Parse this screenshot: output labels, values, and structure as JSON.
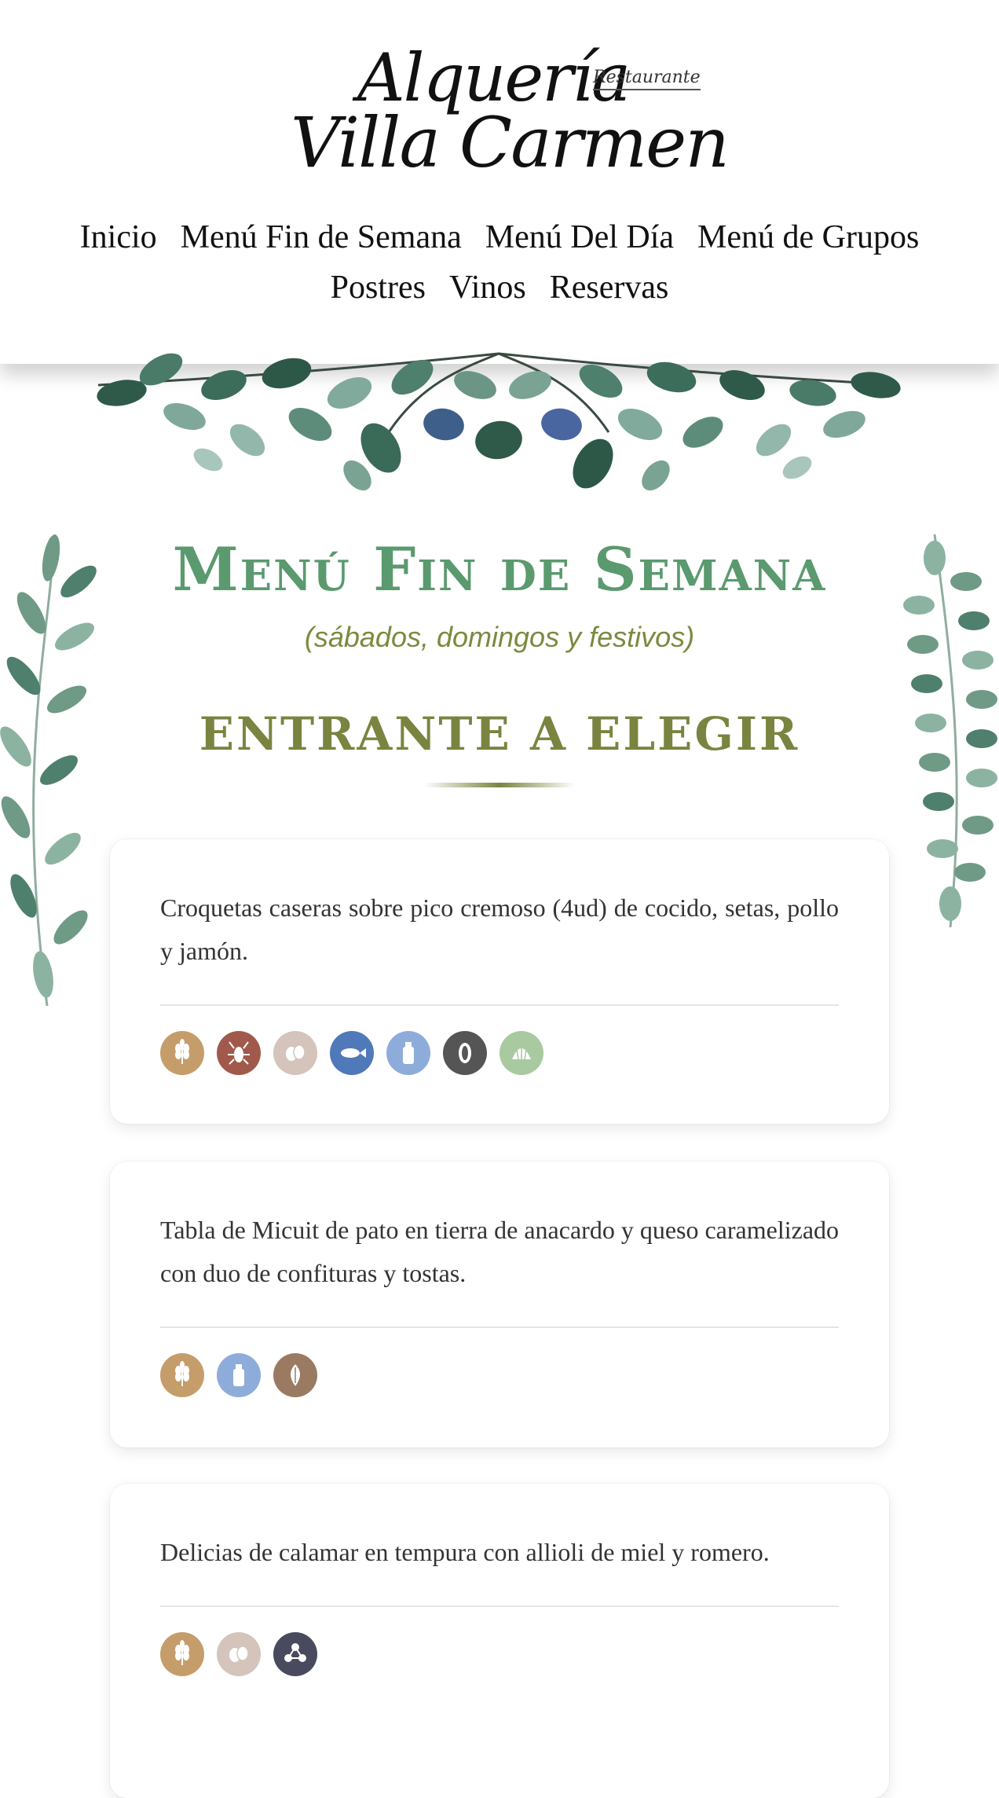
{
  "brand": {
    "line1": "Alquería",
    "tag": "Restaurante",
    "line2": "Villa Carmen"
  },
  "nav": {
    "row1": [
      "Inicio",
      "Menú Fin de Semana",
      "Menú Del Día",
      "Menú de Grupos"
    ],
    "row2": [
      "Postres",
      "Vinos",
      "Reservas"
    ]
  },
  "page": {
    "title": "Menú Fin de Semana",
    "subtitle": "(sábados, domingos y festivos)"
  },
  "section": {
    "title": "ENTRANTE A ELEGIR"
  },
  "dishes": [
    {
      "description": "Croquetas caseras sobre pico cremoso (4ud) de cocido, setas, pollo y jamón.",
      "allergens": [
        "gluten",
        "crustaceans",
        "eggs",
        "fish",
        "milk",
        "peanuts",
        "molluscs"
      ]
    },
    {
      "description": "Tabla de Micuit de pato en tierra de anacardo y queso caramelizado con duo de confituras y tostas.",
      "allergens": [
        "gluten",
        "milk",
        "nuts"
      ]
    },
    {
      "description": "Delicias de calamar en tempura con allioli de miel y romero.",
      "allergens": [
        "gluten",
        "eggs",
        "sulphites"
      ]
    }
  ],
  "allergen_colors": {
    "gluten": "#c59d6b",
    "crustaceans": "#a0594a",
    "eggs": "#d4c4bb",
    "fish": "#4f79b8",
    "milk": "#8eacd9",
    "peanuts": "#555555",
    "molluscs": "#a9c9a0",
    "nuts": "#9b7a62",
    "sulphites": "#4a4a5e"
  },
  "colors": {
    "title_green": "#5a9a6e",
    "olive": "#7a8440"
  }
}
